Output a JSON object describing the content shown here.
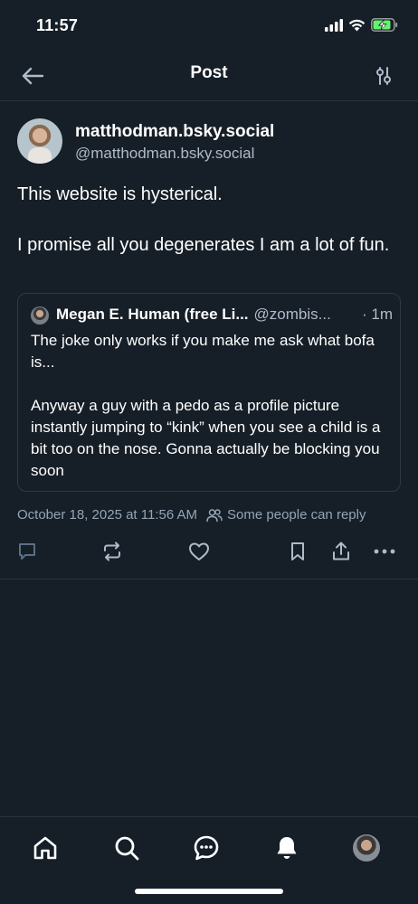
{
  "status_bar": {
    "time": "11:57"
  },
  "header": {
    "title": "Post"
  },
  "post": {
    "display_name": "matthodman.bsky.social",
    "handle": "@matthodman.bsky.social",
    "text": "This website is hysterical.\n\nI promise all you degenerates I am a lot of fun.",
    "quote": {
      "name": "Megan E. Human (free Li...",
      "handle": "@zombis...",
      "time": "· 1m",
      "text": "The joke only works if you make me ask what bofa is...\n\nAnyway a guy with a pedo as a profile picture instantly jumping to “kink” when you see a child is a bit too on the nose. Gonna actually be blocking you soon"
    },
    "timestamp": "October 18, 2025 at 11:56 AM",
    "reply_setting": "Some people can reply"
  },
  "icons": {
    "back": "arrow-left-icon",
    "settings": "sliders-icon",
    "reply": "comment-icon",
    "repost": "repost-icon",
    "like": "heart-icon",
    "bookmark": "bookmark-icon",
    "share": "share-icon",
    "more": "ellipsis-icon",
    "tabs": [
      "home-icon",
      "search-icon",
      "chat-icon",
      "bell-icon",
      "avatar"
    ]
  },
  "colors": {
    "background": "#161e27",
    "text": "#ffffff",
    "muted": "#aebbc9",
    "meta": "#93a5b7",
    "border": "#2a3440",
    "accent": "#62f56a"
  }
}
